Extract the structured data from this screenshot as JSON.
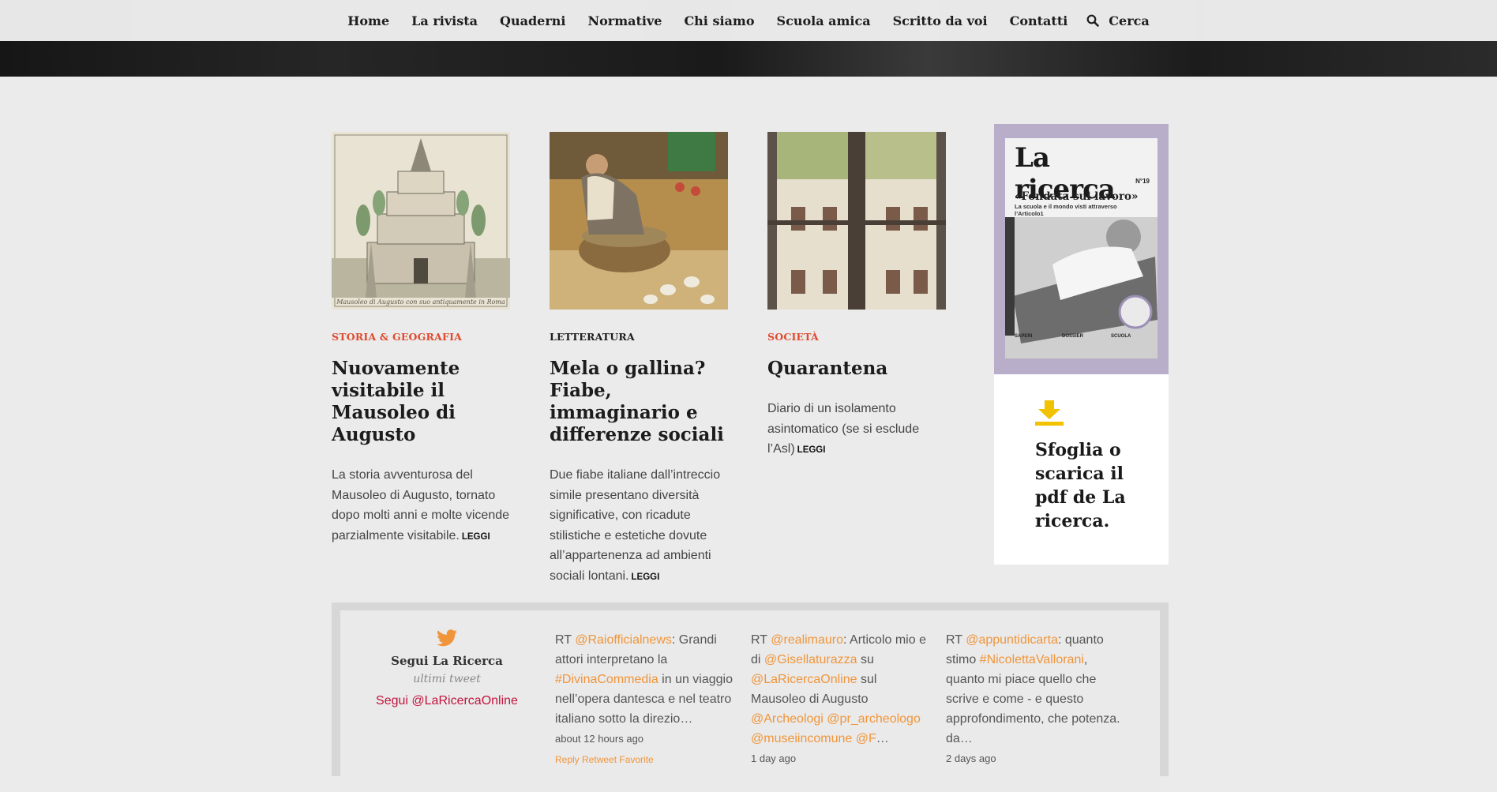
{
  "nav": {
    "items": [
      "Home",
      "La rivista",
      "Quaderni",
      "Normative",
      "Chi siamo",
      "Scuola amica",
      "Scritto da voi",
      "Contatti"
    ],
    "search_label": "Cerca"
  },
  "articles": [
    {
      "category": "Storia & Geografia",
      "category_color": "#e0492d",
      "title": "Nuovamente visitabile il Mausoleo di Augusto",
      "excerpt": "La storia avventurosa del Mausoleo di Augusto, tornato dopo molti anni e molte vicende parzialmente visitabile.",
      "read_more": "LEGGI",
      "image_caption": "Mausoleo di Augusto con suo antiquamente in Roma"
    },
    {
      "category": "Letteratura",
      "category_color": "#1e1e1e",
      "title": "Mela o gallina? Fiabe, immaginario e differenze sociali",
      "excerpt": "Due fiabe italiane dall’intreccio simile presentano diversità significative, con ricadute stilistiche e estetiche dovute all’appartenenza ad ambienti sociali lontani.",
      "read_more": "LEGGI"
    },
    {
      "category": "Società",
      "category_color": "#e0492d",
      "title": "Quarantena",
      "excerpt": "Diario di un isolamento asintomatico (se si esclude l’Asl)",
      "read_more": "LEGGI"
    }
  ],
  "magazine": {
    "cover_title": "La ricerca",
    "cover_number": "N°19",
    "cover_headline": "«Fondata sul lavoro»",
    "cover_subheadline": "La scuola e il mondo visti attraverso l’Articolo1",
    "cover_columns": [
      "SAPERI",
      "DOSSIER",
      "SCUOLA"
    ],
    "download_text": "Sfoglia o scarica il pdf de La ricerca."
  },
  "twitter": {
    "title": "Segui La Ricerca",
    "subtitle": "ultimi tweet",
    "follow_link": "Segui @LaRicercaOnline",
    "tweets": [
      {
        "parts": [
          {
            "t": "RT ",
            "h": false
          },
          {
            "t": "@Raiofficialnews",
            "h": true
          },
          {
            "t": ": Grandi attori interpretano la ",
            "h": false
          },
          {
            "t": "#DivinaCommedia",
            "h": true
          },
          {
            "t": " in un viaggio nell’opera dantesca e nel teatro italiano sotto la direzio…",
            "h": false
          }
        ],
        "time": "about 12 hours ago",
        "actions": "Reply Retweet Favorite"
      },
      {
        "parts": [
          {
            "t": "RT ",
            "h": false
          },
          {
            "t": "@realimauro",
            "h": true
          },
          {
            "t": ": Articolo mio e di ",
            "h": false
          },
          {
            "t": "@Gisellaturazza",
            "h": true
          },
          {
            "t": " su ",
            "h": false
          },
          {
            "t": "@LaRicercaOnline",
            "h": true
          },
          {
            "t": " sul Mausoleo di Augusto ",
            "h": false
          },
          {
            "t": "@Archeologi",
            "h": true
          },
          {
            "t": " ",
            "h": false
          },
          {
            "t": "@pr_archeologo",
            "h": true
          },
          {
            "t": " ",
            "h": false
          },
          {
            "t": "@museiincomune",
            "h": true
          },
          {
            "t": " ",
            "h": false
          },
          {
            "t": "@F",
            "h": true
          },
          {
            "t": "…",
            "h": false
          }
        ],
        "time": "1 day ago"
      },
      {
        "parts": [
          {
            "t": "RT ",
            "h": false
          },
          {
            "t": "@appuntidicarta",
            "h": true
          },
          {
            "t": ": quanto stimo ",
            "h": false
          },
          {
            "t": "#NicolettaVallorani",
            "h": true
          },
          {
            "t": ", quanto mi piace quello che scrive e come - e questo approfondimento, che potenza. da…",
            "h": false
          }
        ],
        "time": "2 days ago"
      }
    ]
  },
  "colors": {
    "accent_orange": "#f0953a",
    "accent_red": "#e0492d",
    "link_crimson": "#c0143c",
    "download_yellow": "#f2c100",
    "cover_frame": "#b8aec9"
  }
}
